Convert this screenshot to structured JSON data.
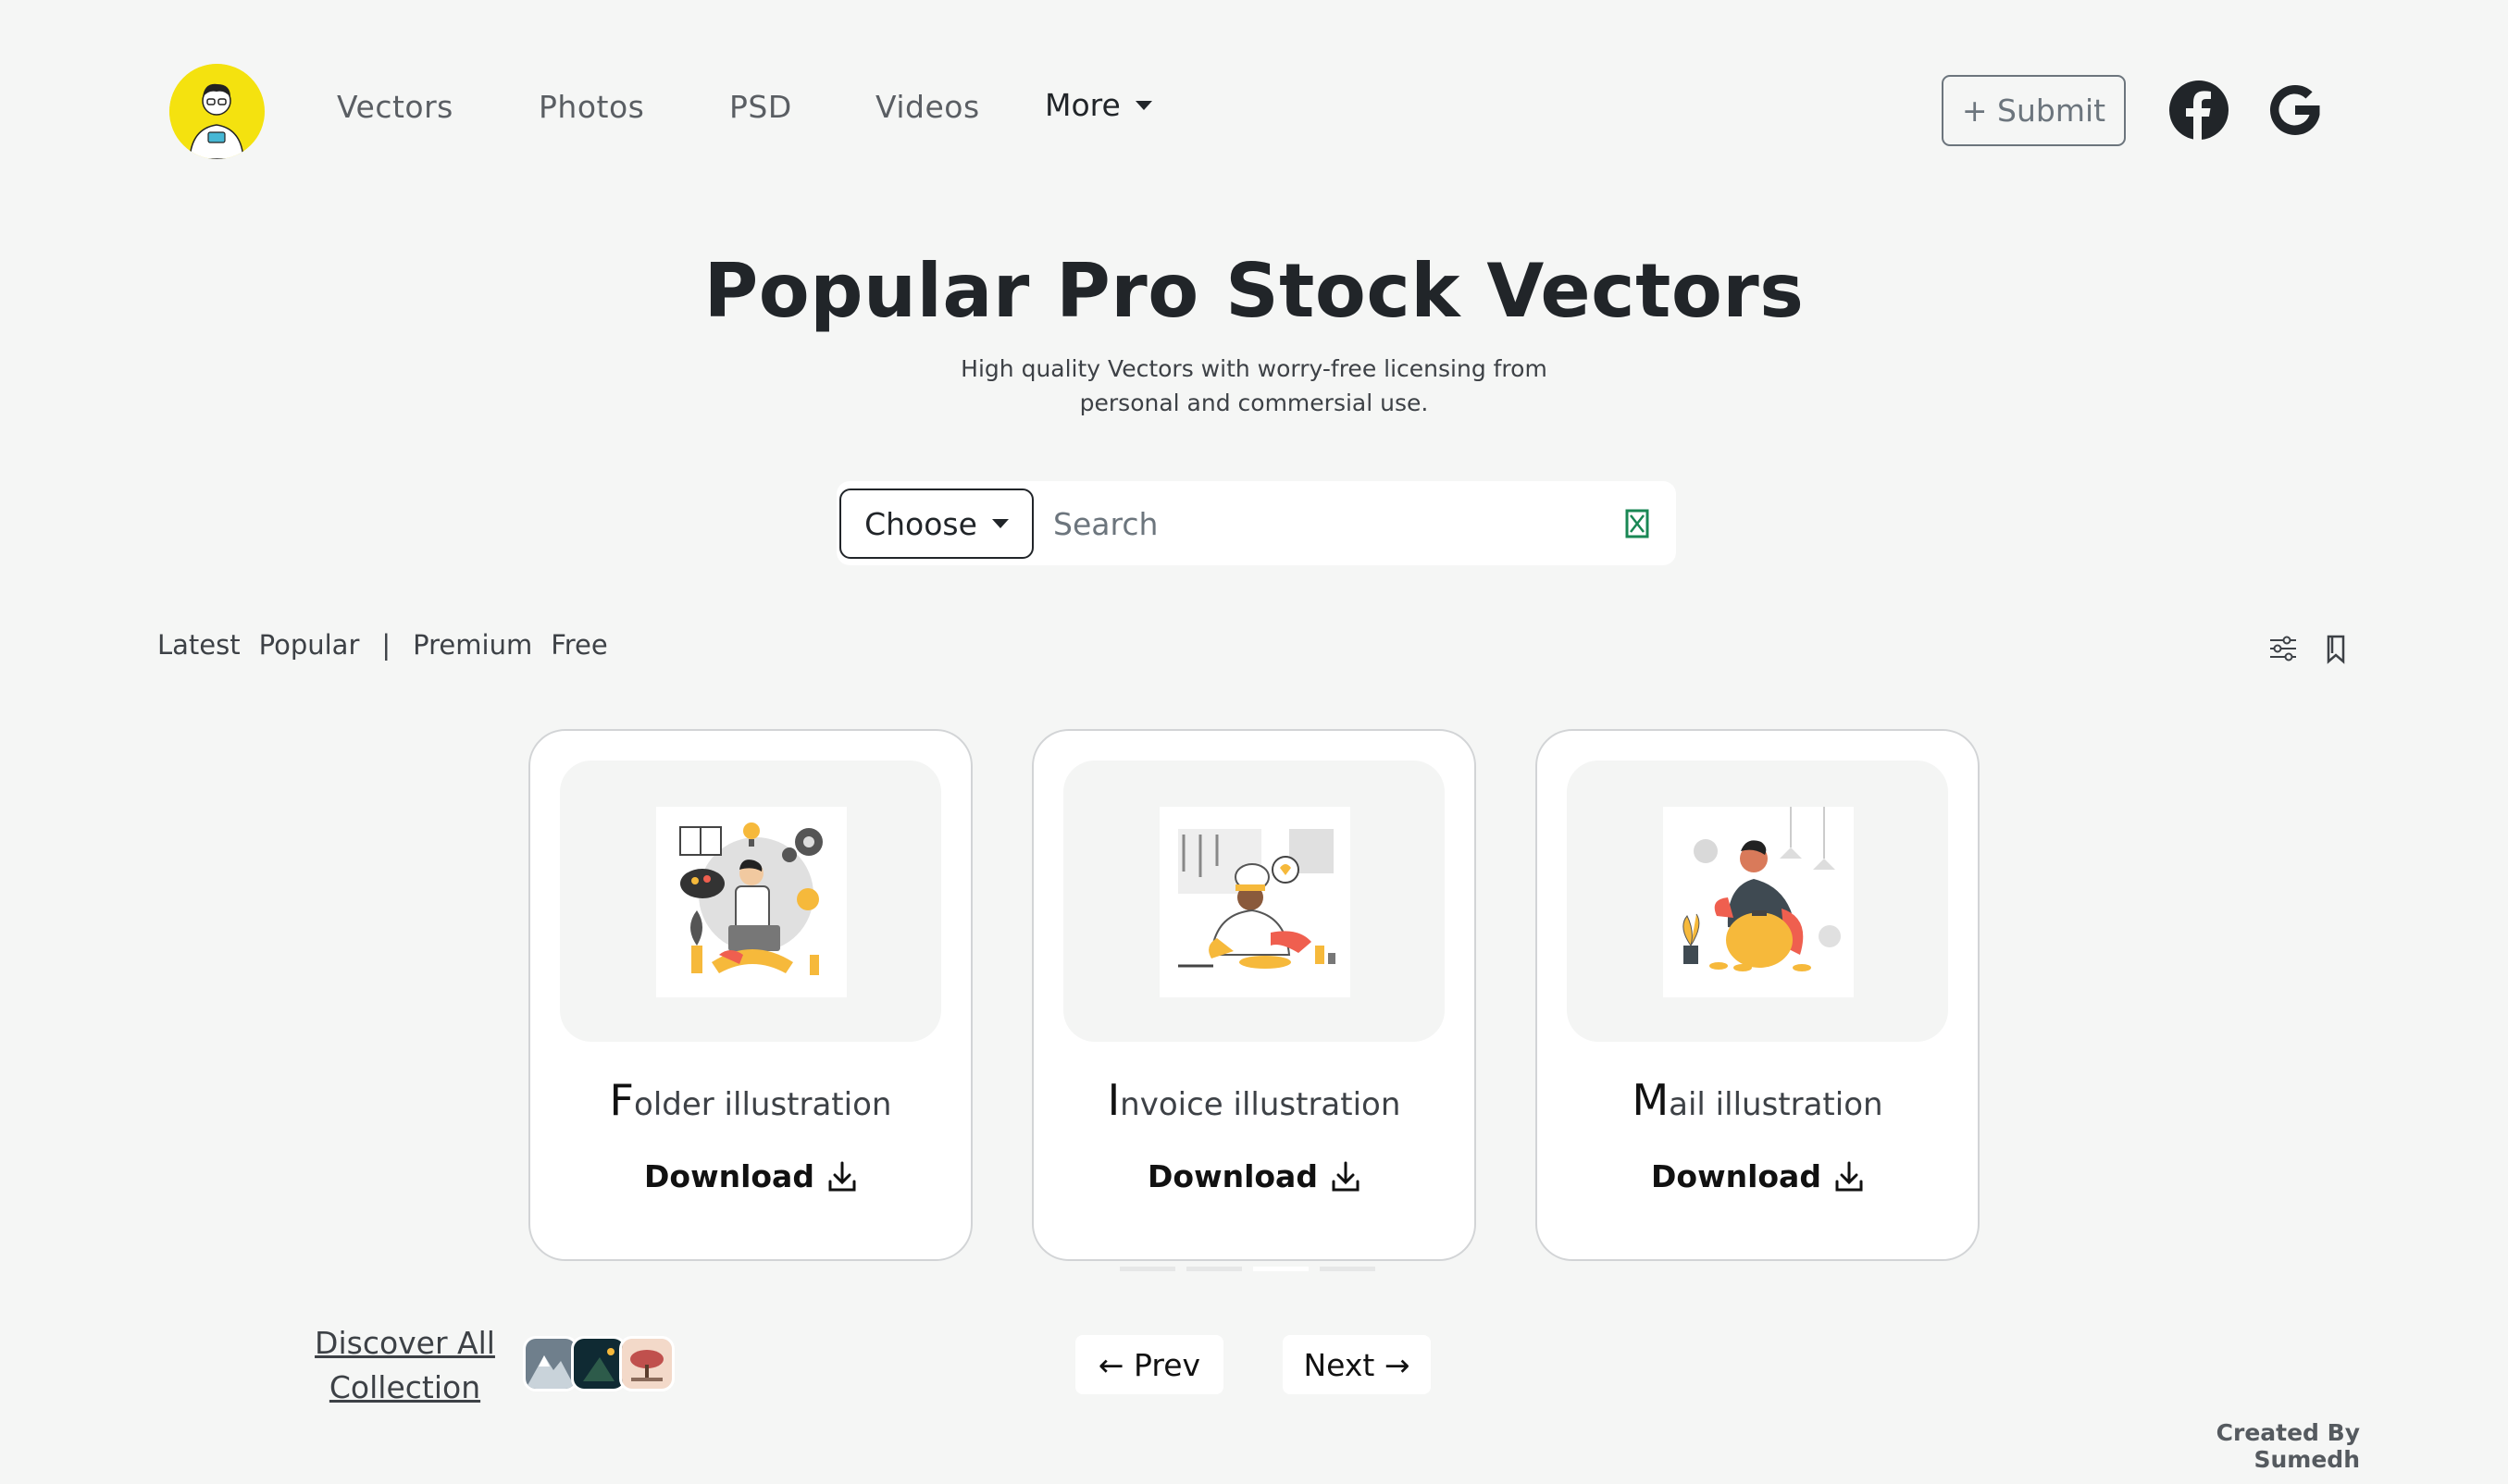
{
  "nav": {
    "links": [
      "Vectors",
      "Photos",
      "PSD",
      "Videos"
    ],
    "more_label": "More",
    "submit_label": "+ Submit",
    "social": [
      "facebook-icon",
      "google-icon"
    ]
  },
  "hero": {
    "title": "Popular Pro Stock Vectors",
    "subtitle": "High quality Vectors with worry-free licensing from personal and commersial use."
  },
  "search": {
    "choose_label": "Choose",
    "placeholder": "Search",
    "value": ""
  },
  "filters": {
    "items": [
      "Latest",
      "Popular",
      "|",
      "Premium",
      "Free"
    ]
  },
  "cards": [
    {
      "first": "F",
      "rest": "older illustration",
      "download_label": "Download"
    },
    {
      "first": "I",
      "rest": "nvoice illustration",
      "download_label": "Download"
    },
    {
      "first": "M",
      "rest": "ail illustration",
      "download_label": "Download"
    }
  ],
  "footer": {
    "discover_label": "Discover All Collection",
    "prev_label": "← Prev",
    "next_label": "Next →",
    "credit": "Created By Sumedh"
  },
  "colors": {
    "background": "#f5f6f5",
    "logo_yellow": "#f4e20f",
    "search_icon_green": "#198754",
    "accent_yellow": "#f6b93b",
    "accent_red": "#ef5f4f"
  }
}
